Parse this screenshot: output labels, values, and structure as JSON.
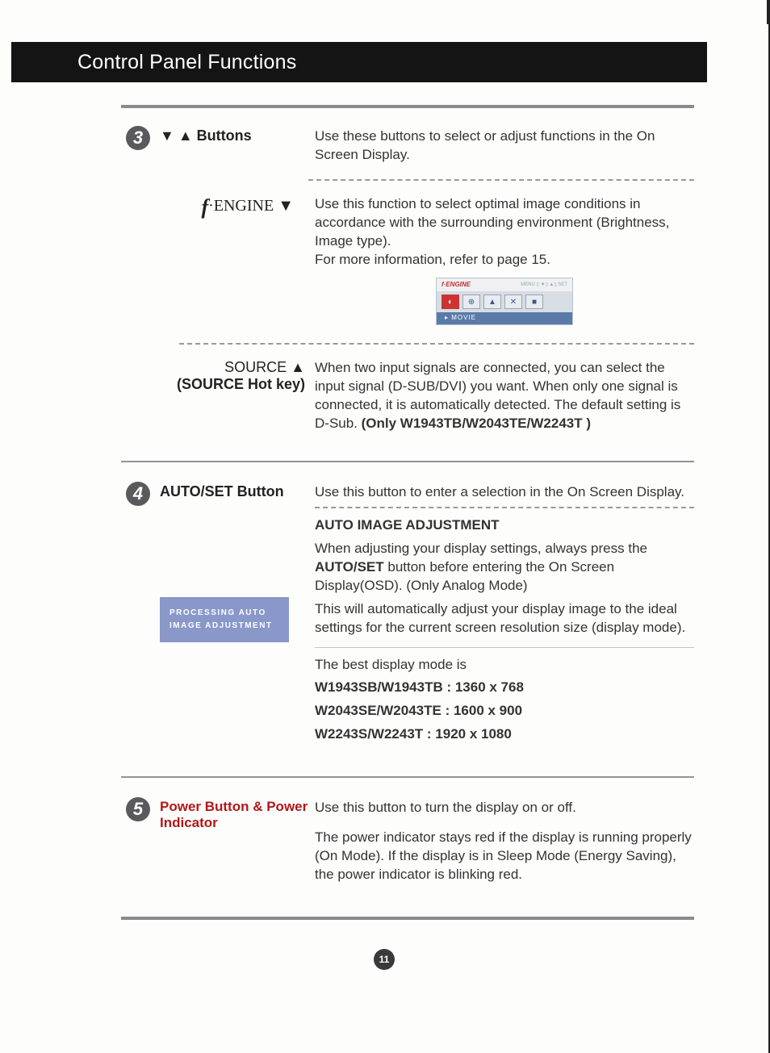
{
  "header": {
    "title": "Control Panel Functions"
  },
  "sections": {
    "s3": {
      "num": "3",
      "label_pre": "▼  ▲ ",
      "label": "Buttons",
      "desc": "Use these buttons to select or adjust functions in the On Screen Display."
    },
    "fengine": {
      "label_f": "f",
      "label_text": "·ENGINE ▼",
      "desc": "Use this function to select optimal image conditions in accordance with the surrounding environment (Brightness, Image type).\nFor more information, refer to page 15.",
      "osd": {
        "brand": "f·ENGINE",
        "menu": "MENU",
        "set": "SET",
        "foot": "▸  MOVIE"
      }
    },
    "source": {
      "label1": "SOURCE ▲",
      "label2": "(SOURCE Hot key)",
      "desc_pre": "When two input signals are connected, you can select the input signal (D-SUB/DVI) you want. When only one signal is connected, it is automatically detected. The default setting is D-Sub. ",
      "desc_bold": "(Only W1943TB/W2043TE/W2243T )"
    },
    "s4": {
      "num": "4",
      "label": "AUTO/SET Button",
      "desc1": "Use this button to enter a selection in the On Screen Display.",
      "subhdr": "AUTO IMAGE ADJUSTMENT",
      "p1a": "When adjusting your display settings, always press the ",
      "p1b": "AUTO/SET",
      "p1c": " button before entering the On Screen Display(OSD). (Only Analog Mode)",
      "p2": "This will automatically adjust your display image to the ideal settings for the current screen resolution size (display mode).",
      "p3": "The best display mode is",
      "res1": "W1943SB/W1943TB : 1360 x 768",
      "res2": "W2043SE/W2043TE : 1600 x 900",
      "res3": "W2243S/W2243T : 1920 x 1080",
      "proc1": "PROCESSING AUTO",
      "proc2": "IMAGE ADJUSTMENT"
    },
    "s5": {
      "num": "5",
      "label": "Power Button & Power Indicator",
      "desc1": "Use this button to turn the display on or off.",
      "desc2": "The power indicator stays red if the display is running properly (On Mode). If the display is in Sleep Mode (Energy Saving), the power indicator is blinking red."
    }
  },
  "page_number": "11"
}
